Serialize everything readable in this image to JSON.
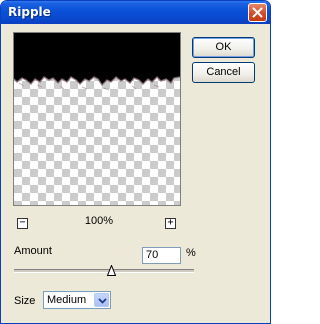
{
  "window": {
    "title": "Ripple"
  },
  "buttons": {
    "ok": "OK",
    "cancel": "Cancel"
  },
  "preview": {
    "zoom_level": "100%",
    "zoom_out_glyph": "−",
    "zoom_in_glyph": "+"
  },
  "amount": {
    "label": "Amount",
    "value": "70",
    "unit": "%",
    "slider_fraction": 0.54
  },
  "size": {
    "label": "Size",
    "selected": "Medium"
  },
  "colors": {
    "titlebar": "#0a4bd0",
    "dialog_bg": "#ece9d8",
    "close": "#d04a23"
  }
}
